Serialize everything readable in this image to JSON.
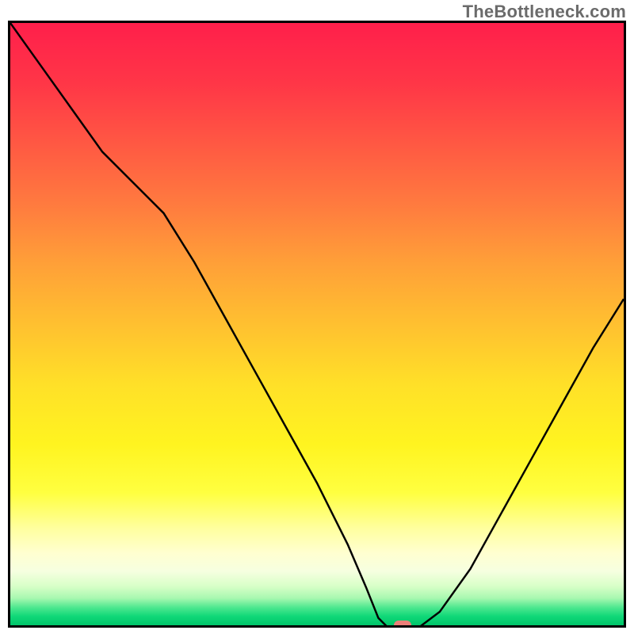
{
  "watermark": "TheBottleneck.com",
  "chart_data": {
    "type": "line",
    "title": "",
    "xlabel": "",
    "ylabel": "",
    "xlim": [
      0,
      100
    ],
    "ylim": [
      0,
      100
    ],
    "x": [
      0,
      5,
      10,
      15,
      20,
      25,
      30,
      35,
      40,
      45,
      50,
      55,
      58,
      60,
      62,
      64,
      66,
      70,
      75,
      80,
      85,
      90,
      95,
      100
    ],
    "values": [
      100,
      93,
      86,
      79,
      74,
      69,
      61,
      52,
      43,
      34,
      25,
      15,
      8,
      3,
      1,
      0,
      1,
      4,
      11,
      20,
      29,
      38,
      47,
      55
    ],
    "series": [
      {
        "name": "bottleneck-curve",
        "x_ref": "x",
        "y_ref": "values"
      }
    ],
    "min_marker": {
      "x": 64,
      "y": 0,
      "color": "#ec8079"
    },
    "gradient_stops": [
      {
        "pos": 0.0,
        "color": "#ff1f4b"
      },
      {
        "pos": 0.1,
        "color": "#ff3647"
      },
      {
        "pos": 0.2,
        "color": "#ff5843"
      },
      {
        "pos": 0.3,
        "color": "#ff7a3f"
      },
      {
        "pos": 0.4,
        "color": "#ffa038"
      },
      {
        "pos": 0.5,
        "color": "#ffc030"
      },
      {
        "pos": 0.6,
        "color": "#ffe028"
      },
      {
        "pos": 0.7,
        "color": "#fff420"
      },
      {
        "pos": 0.78,
        "color": "#ffff40"
      },
      {
        "pos": 0.84,
        "color": "#ffffa0"
      },
      {
        "pos": 0.88,
        "color": "#ffffd0"
      },
      {
        "pos": 0.91,
        "color": "#f6ffe0"
      },
      {
        "pos": 0.935,
        "color": "#d8ffc8"
      },
      {
        "pos": 0.955,
        "color": "#a8f8b0"
      },
      {
        "pos": 0.97,
        "color": "#50e890"
      },
      {
        "pos": 0.985,
        "color": "#10d878"
      },
      {
        "pos": 1.0,
        "color": "#00c56a"
      }
    ],
    "axes_visible": false,
    "grid": false
  },
  "colors": {
    "border": "#000000",
    "curve": "#000000",
    "watermark": "#6b6b6b"
  }
}
